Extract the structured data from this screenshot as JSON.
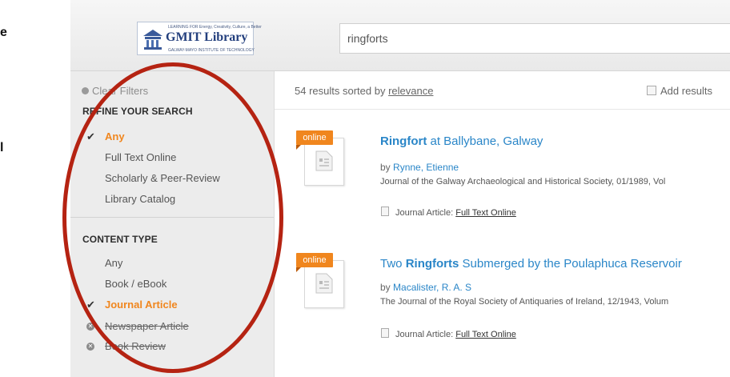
{
  "doc_fragments": [
    "e",
    "l"
  ],
  "header": {
    "logo": {
      "top_text": "LEARNING FOR Energy, Creativity, Culture, a Better",
      "name": "GMIT Library",
      "bottom_text": "GALWAY-MAYO INSTITUTE OF TECHNOLOGY"
    },
    "search": {
      "value": "ringforts"
    }
  },
  "sidebar": {
    "clear_filters": "Clear Filters",
    "refine_title": "REFINE YOUR SEARCH",
    "refine_items": [
      "Any",
      "Full Text Online",
      "Scholarly & Peer-Review",
      "Library Catalog"
    ],
    "content_type_title": "CONTENT TYPE",
    "content_items": [
      "Any",
      "Book / eBook",
      "Journal Article",
      "Newspaper Article",
      "Book Review"
    ]
  },
  "results": {
    "count_text": "54 results sorted by",
    "sort_link": "relevance",
    "add_results": "Add results",
    "items": [
      {
        "badge": "online",
        "title_bold": "Ringfort",
        "title_rest": " at Ballybane, Galway",
        "by": "by",
        "author": "Rynne, Etienne",
        "publication": "Journal of the Galway Archaeological and Historical Society, 01/1989, Vol",
        "type": "Journal Article:",
        "fulltext": "Full Text Online"
      },
      {
        "badge": "online",
        "title_pre": "Two ",
        "title_bold": "Ringforts",
        "title_rest": " Submerged by the Poulaphuca Reservoir",
        "by": "by",
        "author": "Macalister, R. A. S",
        "publication": "The Journal of the Royal Society of Antiquaries of Ireland, 12/1943, Volum",
        "type": "Journal Article:",
        "fulltext": "Full Text Online"
      }
    ]
  },
  "colors": {
    "accent_orange": "#f0861e",
    "link_blue": "#2a86c8",
    "annotation_red": "#b52312"
  }
}
